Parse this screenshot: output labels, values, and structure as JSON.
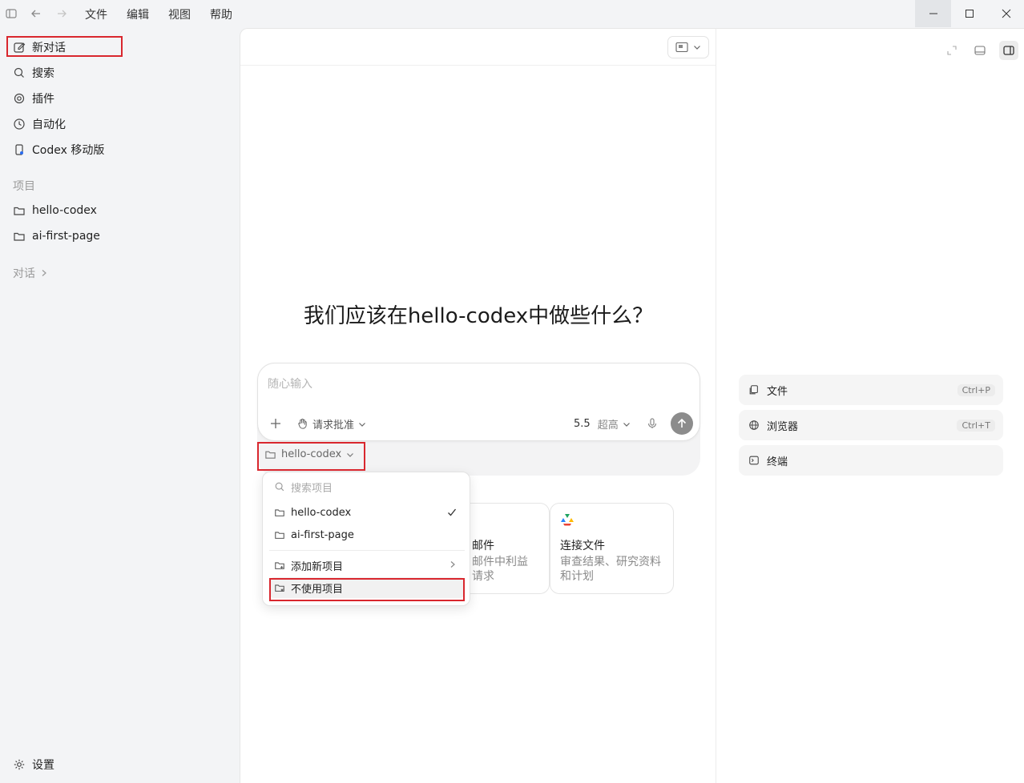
{
  "menubar": {
    "items": [
      "文件",
      "编辑",
      "视图",
      "帮助"
    ]
  },
  "sidebar": {
    "nav": [
      {
        "label": "新对话",
        "icon": "edit-icon"
      },
      {
        "label": "搜索",
        "icon": "search-icon"
      },
      {
        "label": "插件",
        "icon": "at-icon"
      },
      {
        "label": "自动化",
        "icon": "clock-icon"
      },
      {
        "label": "Codex 移动版",
        "icon": "phone-icon"
      }
    ],
    "projects_label": "项目",
    "projects": [
      "hello-codex",
      "ai-first-page"
    ],
    "chats_label": "对话",
    "settings_label": "设置"
  },
  "main": {
    "headline": "我们应该在hello-codex中做些什么？",
    "composer": {
      "placeholder": "随心输入",
      "approval_label": "请求批准",
      "model_version": "5.5",
      "reasoning_level": "超高"
    },
    "project_selector": "hello-codex",
    "cards": [
      {
        "title": "邮件",
        "desc": "邮件中利益请求"
      },
      {
        "title": "连接文件",
        "desc": "审查结果、研究资料和计划"
      }
    ]
  },
  "dropdown": {
    "search_placeholder": "搜索项目",
    "projects": [
      "hello-codex",
      "ai-first-page"
    ],
    "selected": "hello-codex",
    "add_project": "添加新项目",
    "no_project": "不使用项目"
  },
  "right_panel": {
    "tools": [
      {
        "label": "文件",
        "shortcut": "Ctrl+P",
        "icon": "files-icon"
      },
      {
        "label": "浏览器",
        "shortcut": "Ctrl+T",
        "icon": "globe-icon"
      },
      {
        "label": "终端",
        "shortcut": "",
        "icon": "terminal-icon"
      }
    ]
  },
  "colors": {
    "highlight": "#d9272e",
    "send": "#8c8c8c"
  }
}
